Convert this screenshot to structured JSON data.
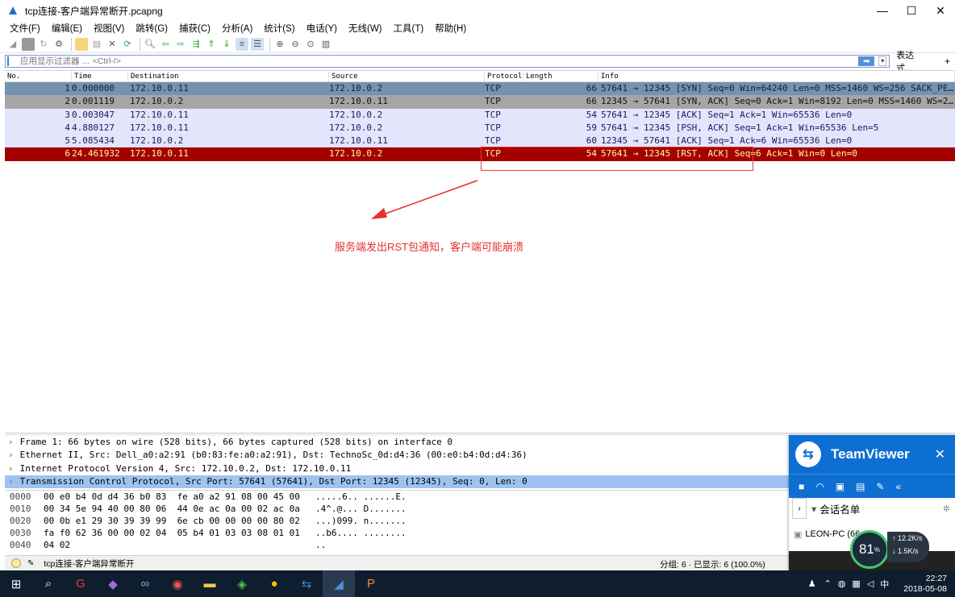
{
  "window": {
    "title": "tcp连接-客户端异常断开.pcapng",
    "minimize": "—",
    "maximize": "☐",
    "close": "✕"
  },
  "menu": [
    "文件(F)",
    "编辑(E)",
    "视图(V)",
    "跳转(G)",
    "捕获(C)",
    "分析(A)",
    "统计(S)",
    "电话(Y)",
    "无线(W)",
    "工具(T)",
    "帮助(H)"
  ],
  "filter": {
    "placeholder": "应用显示过滤器 … <Ctrl-/>",
    "expression_label": "表达式…",
    "plus": "+"
  },
  "columns": [
    "No.",
    "Time",
    "Destination",
    "Source",
    "Protocol",
    "Length",
    "Info"
  ],
  "packets": [
    {
      "no": "1",
      "time": "0.000000",
      "dst": "172.10.0.11",
      "src": "172.10.0.2",
      "proto": "TCP",
      "len": "66",
      "info": "57641 → 12345 [SYN] Seq=0 Win=64240 Len=0 MSS=1460 WS=256 SACK_PE…",
      "color": "#7592b0"
    },
    {
      "no": "2",
      "time": "0.001119",
      "dst": "172.10.0.2",
      "src": "172.10.0.11",
      "proto": "TCP",
      "len": "66",
      "info": "12345 → 57641 [SYN, ACK] Seq=0 Ack=1 Win=8192 Len=0 MSS=1460 WS=2…",
      "color": "#a5a5a5"
    },
    {
      "no": "3",
      "time": "0.003047",
      "dst": "172.10.0.11",
      "src": "172.10.0.2",
      "proto": "TCP",
      "len": "54",
      "info": "57641 → 12345 [ACK] Seq=1 Ack=1 Win=65536 Len=0",
      "color": "#e4e4fb"
    },
    {
      "no": "4",
      "time": "4.880127",
      "dst": "172.10.0.11",
      "src": "172.10.0.2",
      "proto": "TCP",
      "len": "59",
      "info": "57641 → 12345 [PSH, ACK] Seq=1 Ack=1 Win=65536 Len=5",
      "color": "#e4e4fb"
    },
    {
      "no": "5",
      "time": "5.085434",
      "dst": "172.10.0.2",
      "src": "172.10.0.11",
      "proto": "TCP",
      "len": "60",
      "info": "12345 → 57641 [ACK] Seq=1 Ack=6 Win=65536 Len=0",
      "color": "#e4e4fb"
    },
    {
      "no": "6",
      "time": "24.461932",
      "dst": "172.10.0.11",
      "src": "172.10.0.2",
      "proto": "TCP",
      "len": "54",
      "info": "57641 → 12345 [RST, ACK] Seq=6 Ack=1 Win=0 Len=0",
      "color": "#a40000"
    }
  ],
  "annotation": {
    "text": "服务端发出RST包通知，客户端可能崩溃",
    "color": "#e53030"
  },
  "details": [
    "Frame 1: 66 bytes on wire (528 bits), 66 bytes captured (528 bits) on interface 0",
    "Ethernet II, Src: Dell_a0:a2:91 (b0:83:fe:a0:a2:91), Dst: TechnoSc_0d:d4:36 (00:e0:b4:0d:d4:36)",
    "Internet Protocol Version 4, Src: 172.10.0.2, Dst: 172.10.0.11",
    "Transmission Control Protocol, Src Port: 57641 (57641), Dst Port: 12345 (12345), Seq: 0, Len: 0"
  ],
  "bytes": [
    {
      "off": "0000",
      "hex": "00 e0 b4 0d d4 36 b0 83  fe a0 a2 91 08 00 45 00",
      "ascii": ".....6.. ......E."
    },
    {
      "off": "0010",
      "hex": "00 34 5e 94 40 00 80 06  44 0e ac 0a 00 02 ac 0a",
      "ascii": ".4^.@... D......."
    },
    {
      "off": "0020",
      "hex": "00 0b e1 29 30 39 39 99  6e cb 00 00 00 00 80 02",
      "ascii": "...)099. n......."
    },
    {
      "off": "0030",
      "hex": "fa f0 62 36 00 00 02 04  05 b4 01 03 03 08 01 01",
      "ascii": "..b6.... ........"
    },
    {
      "off": "0040",
      "hex": "04 02",
      "ascii": ".."
    }
  ],
  "status": {
    "file": "tcp连接-客户端异常断开",
    "packets": "分组: 6 · 已显示: 6 (100.0%)"
  },
  "teamviewer": {
    "title": "TeamViewer",
    "close": "✕",
    "section": "会话名单",
    "item": "LEON-PC (66…"
  },
  "gauge": {
    "value": "81",
    "unit": "%",
    "up": "12.2K/s",
    "down": "1.5K/s"
  },
  "taskbar": {
    "time": "22:27",
    "date": "2018-05-08",
    "ime": "中"
  }
}
